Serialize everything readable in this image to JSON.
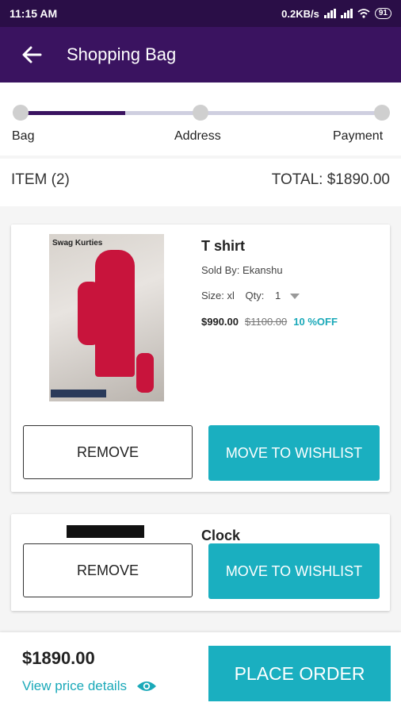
{
  "status": {
    "time": "11:15 AM",
    "speed": "0.2KB/s",
    "battery": "91"
  },
  "header": {
    "title": "Shopping Bag"
  },
  "steps": [
    {
      "label": "Bag"
    },
    {
      "label": "Address"
    },
    {
      "label": "Payment"
    }
  ],
  "summary": {
    "items": "ITEM (2)",
    "total": "TOTAL: $1890.00"
  },
  "cart": [
    {
      "name": "T shirt",
      "sold_by": "Sold By: Ekanshu",
      "size": "Size: xl",
      "qty_label": "Qty:",
      "qty": "1",
      "price": "$990.00",
      "mrp": "$1100.00",
      "discount": "10 %OFF",
      "image_caption": "Swag Kurties",
      "remove_label": "REMOVE",
      "wishlist_label": "MOVE TO WISHLIST"
    },
    {
      "name": "Clock",
      "remove_label": "REMOVE",
      "wishlist_label": "MOVE TO WISHLIST"
    }
  ],
  "footer": {
    "total": "$1890.00",
    "view_details": "View price details",
    "place_order": "PLACE ORDER"
  },
  "colors": {
    "brand": "#3a1360",
    "accent": "#1aafc0"
  },
  "icons": [
    "back-arrow-icon",
    "wifi-icon",
    "signal-icon",
    "battery-icon",
    "eye-icon",
    "dropdown-caret-icon"
  ]
}
